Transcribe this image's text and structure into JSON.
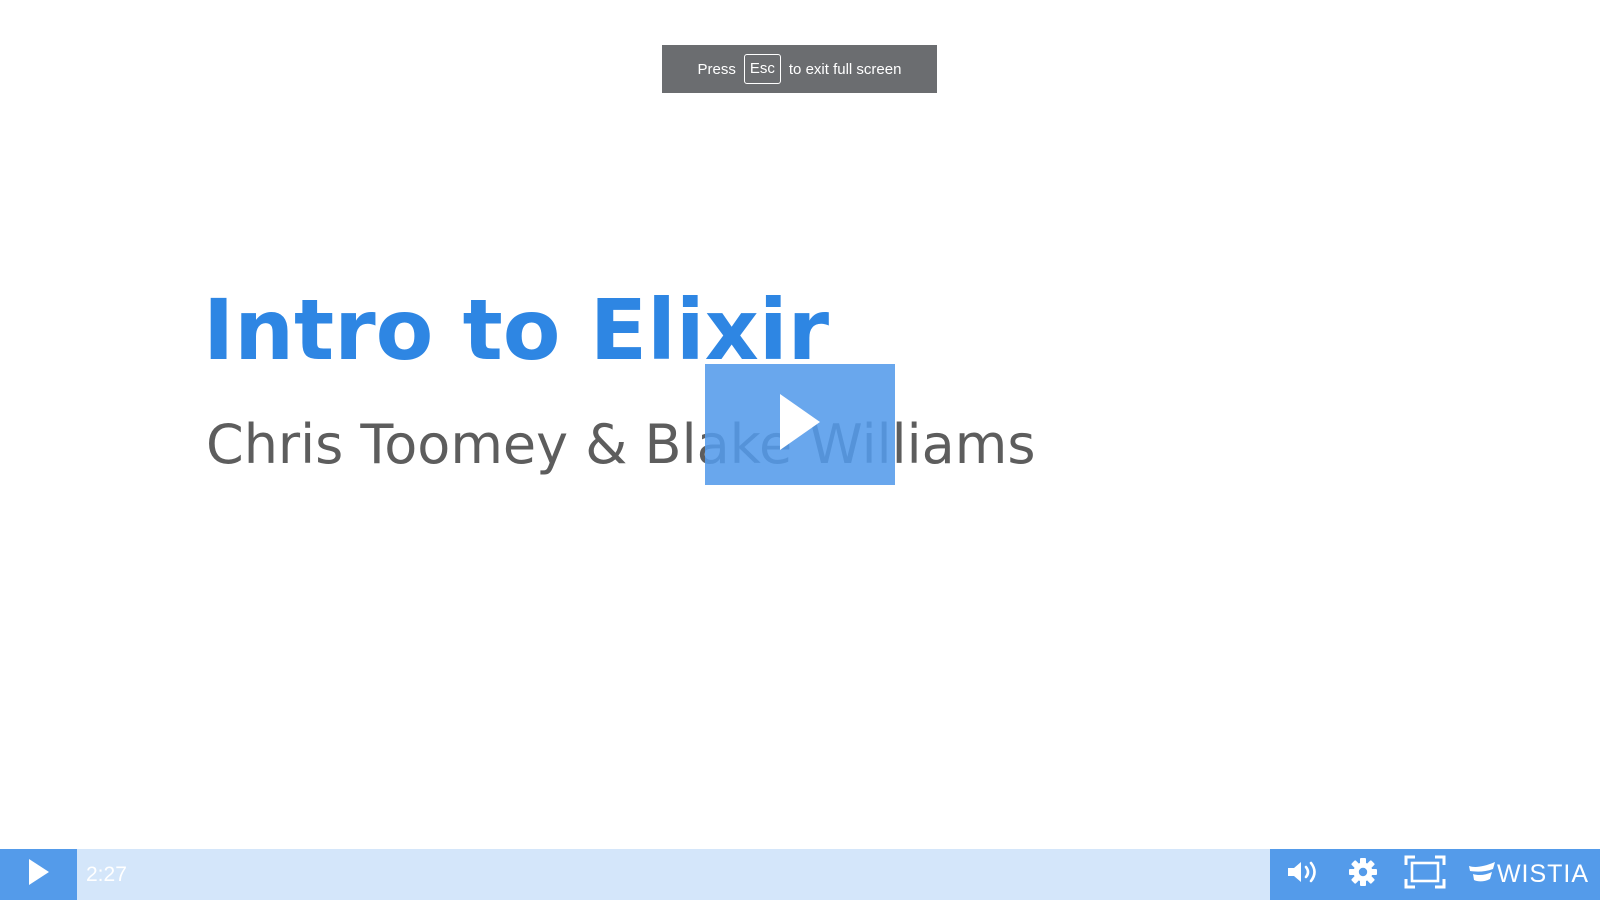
{
  "fullscreen_notice": {
    "prefix": "Press",
    "key": "Esc",
    "suffix": "to exit full screen"
  },
  "slide": {
    "title": "Intro to Elixir",
    "subtitle": "Chris Toomey & Blake Williams"
  },
  "player": {
    "current_time": "2:27",
    "brand": "WISTIA",
    "icons": {
      "big_play": "play-icon",
      "play": "play-icon",
      "volume": "volume-icon",
      "settings": "gear-icon",
      "fullscreen": "fullscreen-icon",
      "logo": "wistia-logo"
    },
    "colors": {
      "accent": "#549bea",
      "title": "#2e86e3",
      "subtitle": "#5d5d5d",
      "notice_bg": "#6b6d70"
    }
  }
}
